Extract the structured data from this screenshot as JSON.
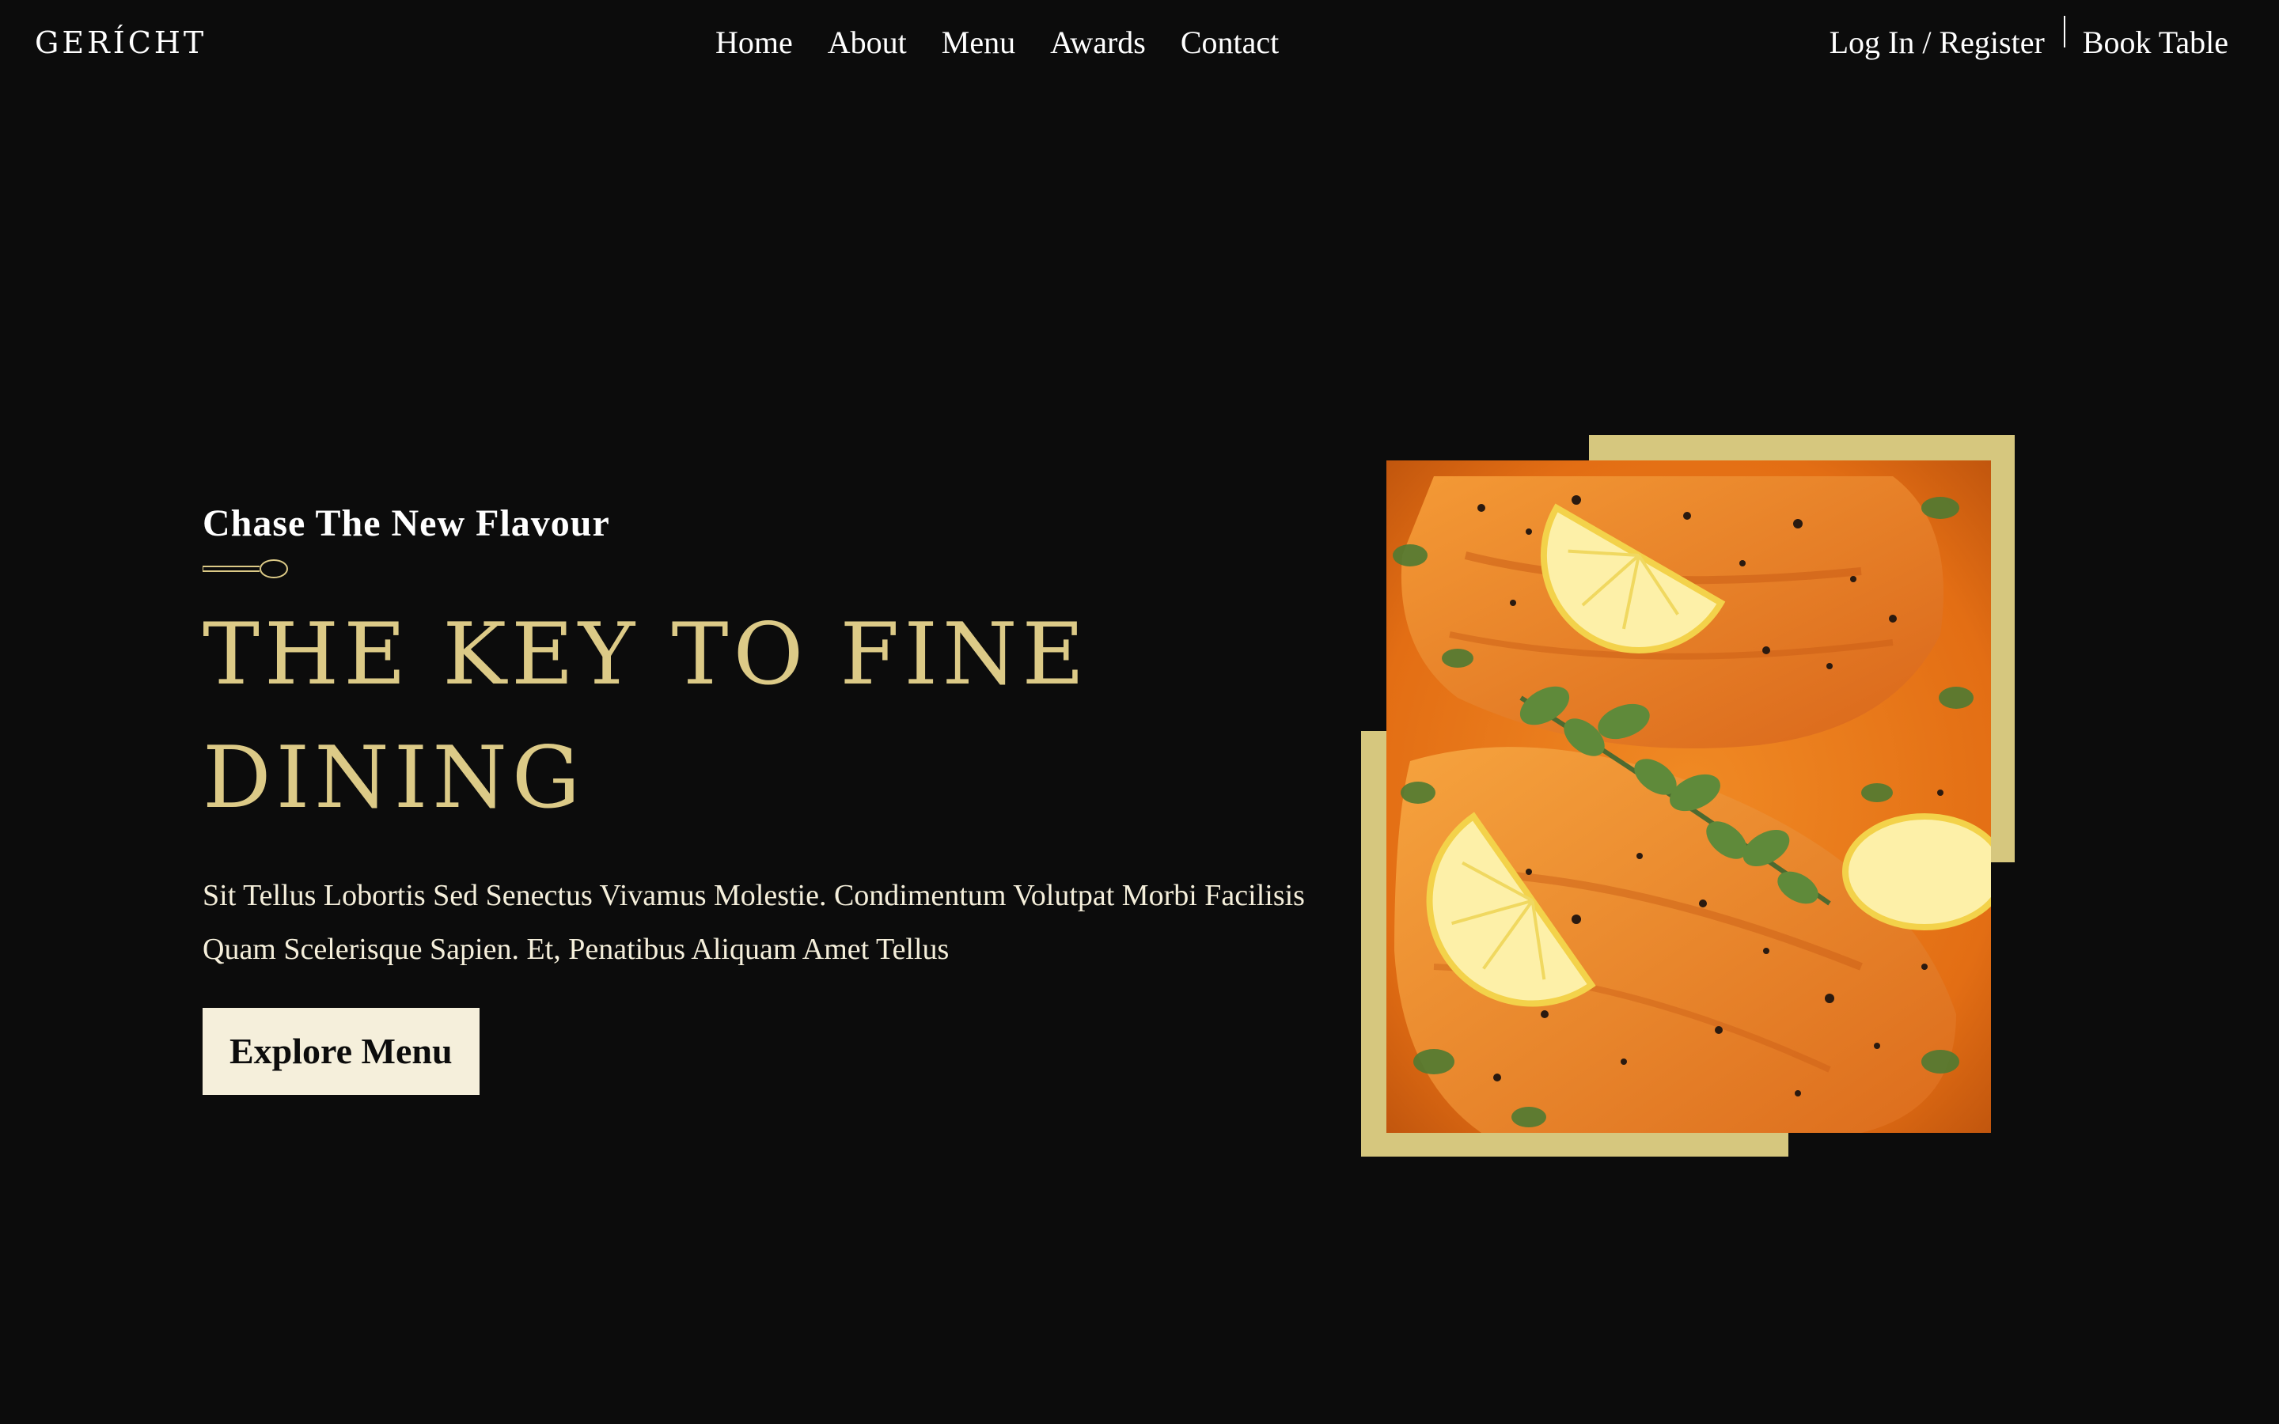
{
  "navbar": {
    "logo": "GERÍCHT",
    "links": [
      "Home",
      "About",
      "Menu",
      "Awards",
      "Contact"
    ],
    "login": "Log In / Register",
    "book": "Book Table"
  },
  "hero": {
    "subtitle": "Chase The New Flavour",
    "headline_line1": "THE KEY TO FINE",
    "headline_line2": "DINING",
    "description": "Sit Tellus Lobortis Sed Senectus Vivamus Molestie. Condimentum Volutpat Morbi Facilisis Quam Scelerisque Sapien. Et, Penatibus Aliquam Amet Tellus",
    "cta_label": "Explore Menu",
    "image_alt": "salmon-with-lemon-and-herbs"
  },
  "colors": {
    "background": "#0c0c0c",
    "gold": "#dcca87",
    "frame": "#d6c77e",
    "cream": "#f5efdb",
    "white": "#ffffff"
  },
  "icons": {
    "spoon": "spoon-icon"
  }
}
